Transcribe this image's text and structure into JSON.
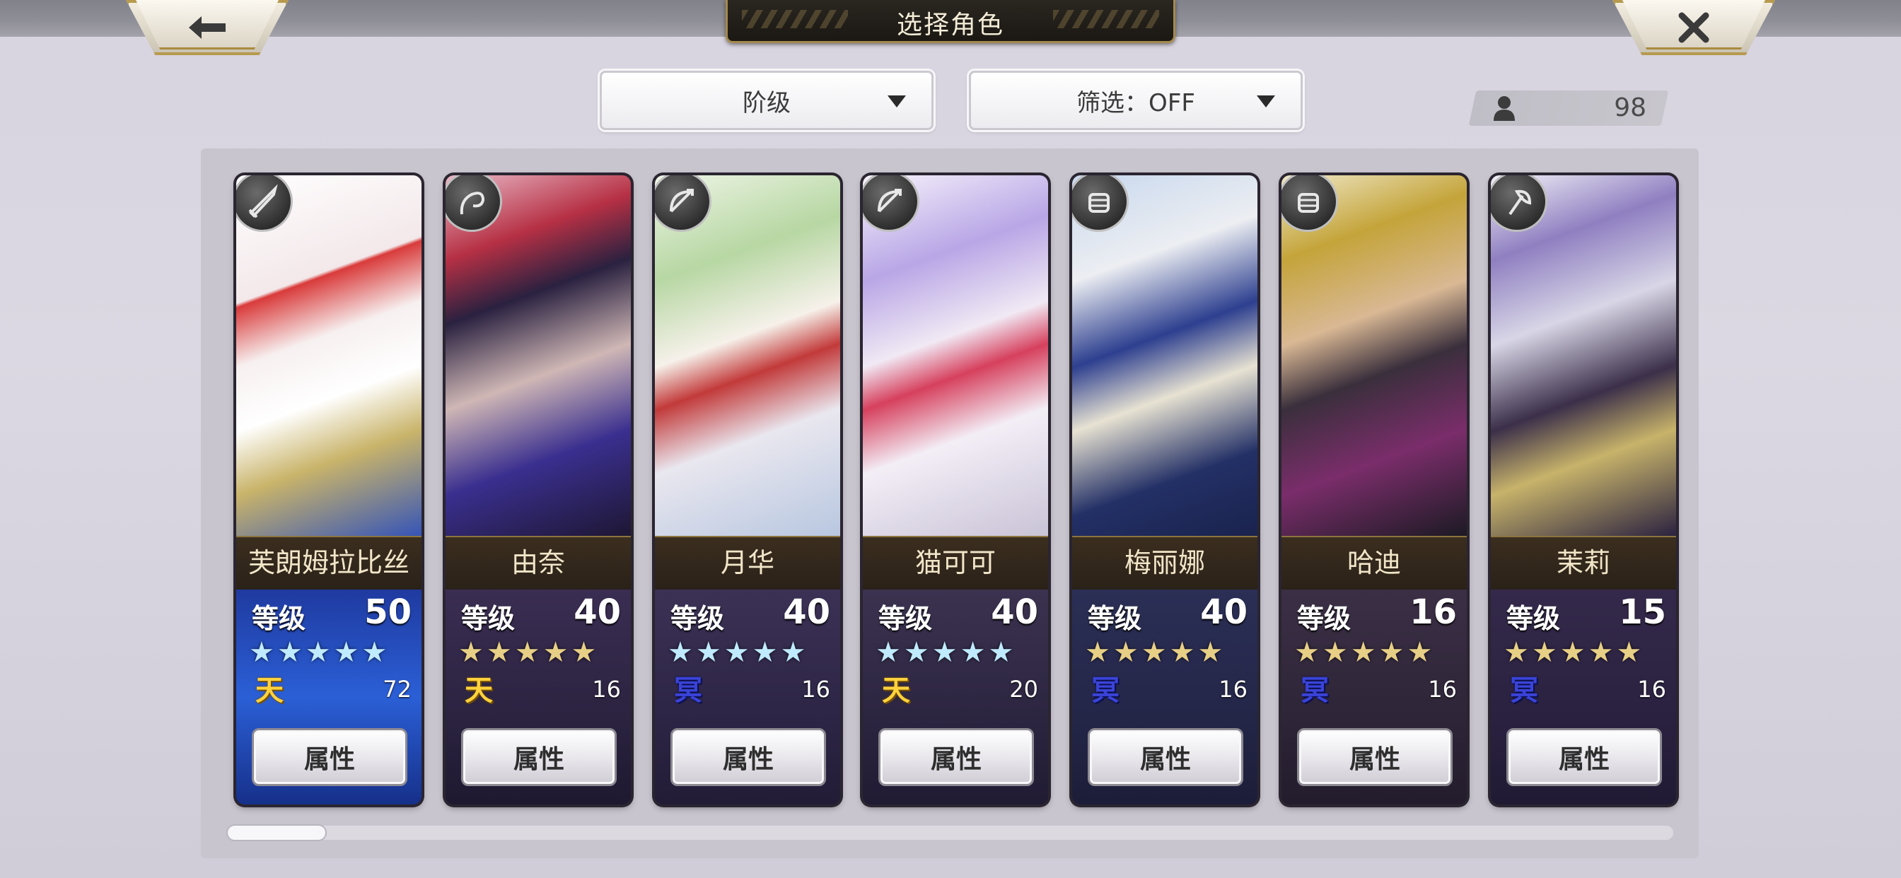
{
  "header": {
    "title": "选择角色"
  },
  "toolbar": {
    "back_icon": "back-arrow-icon",
    "close_icon": "close-x-icon",
    "sort_dropdown": "阶级",
    "filter_dropdown": "筛选：OFF",
    "character_count": "98",
    "count_icon": "person-icon"
  },
  "cards": [
    {
      "name": "芙朗姆拉比丝",
      "level_label": "等级",
      "level": "50",
      "stars": "★★★★★",
      "star_color": "blue",
      "element": "天",
      "element_type": "ten",
      "count": "72",
      "button": "属性",
      "weapon_icon": "sword-icon",
      "palette": "red"
    },
    {
      "name": "由奈",
      "level_label": "等级",
      "level": "40",
      "stars": "★★★★★",
      "star_color": "gold",
      "element": "天",
      "element_type": "ten",
      "count": "16",
      "button": "属性",
      "weapon_icon": "whip-icon",
      "palette": "purple"
    },
    {
      "name": "月华",
      "level_label": "等级",
      "level": "40",
      "stars": "★★★★★",
      "star_color": "blue",
      "element": "冥",
      "element_type": "mei",
      "count": "16",
      "button": "属性",
      "weapon_icon": "bow-icon",
      "palette": "green"
    },
    {
      "name": "猫可可",
      "level_label": "等级",
      "level": "40",
      "stars": "★★★★★",
      "star_color": "blue",
      "element": "天",
      "element_type": "ten",
      "count": "20",
      "button": "属性",
      "weapon_icon": "bow-icon",
      "palette": "lavender"
    },
    {
      "name": "梅丽娜",
      "level_label": "等级",
      "level": "40",
      "stars": "★★★★★",
      "star_color": "gold",
      "element": "冥",
      "element_type": "mei",
      "count": "16",
      "button": "属性",
      "weapon_icon": "fist-icon",
      "palette": "silver"
    },
    {
      "name": "哈迪",
      "level_label": "等级",
      "level": "16",
      "stars": "★★★★★",
      "star_color": "gold",
      "element": "冥",
      "element_type": "mei",
      "count": "16",
      "button": "属性",
      "weapon_icon": "fist-icon",
      "palette": "blond"
    },
    {
      "name": "茉莉",
      "level_label": "等级",
      "level": "15",
      "stars": "★★★★★",
      "star_color": "gold",
      "element": "冥",
      "element_type": "mei",
      "count": "16",
      "button": "属性",
      "weapon_icon": "axe-icon",
      "palette": "pale"
    }
  ],
  "scrollbar": {
    "position": 0
  }
}
